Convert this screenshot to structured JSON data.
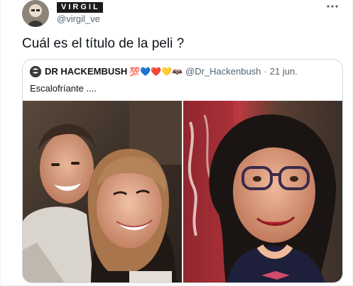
{
  "author": {
    "name": "VIRGIL",
    "handle": "@virgil_ve",
    "avatar_icon": "profile-photo"
  },
  "tweet": {
    "text": "Cuál es el título de la peli ?",
    "more_icon": "more-horizontal-icon"
  },
  "quoted_tweet": {
    "name": "DR HACKEMBUSH",
    "emojis": "💯💙❤️💛🦇",
    "handle": "@Dr_Hackenbush",
    "separator": "·",
    "date": "21 jun.",
    "text": "Escalofríante ....",
    "photos": [
      {
        "name": "photo-couple"
      },
      {
        "name": "photo-woman-glasses"
      }
    ]
  },
  "colors": {
    "text_primary": "#0f1419",
    "text_secondary": "#536471",
    "border": "#cfd9de"
  }
}
